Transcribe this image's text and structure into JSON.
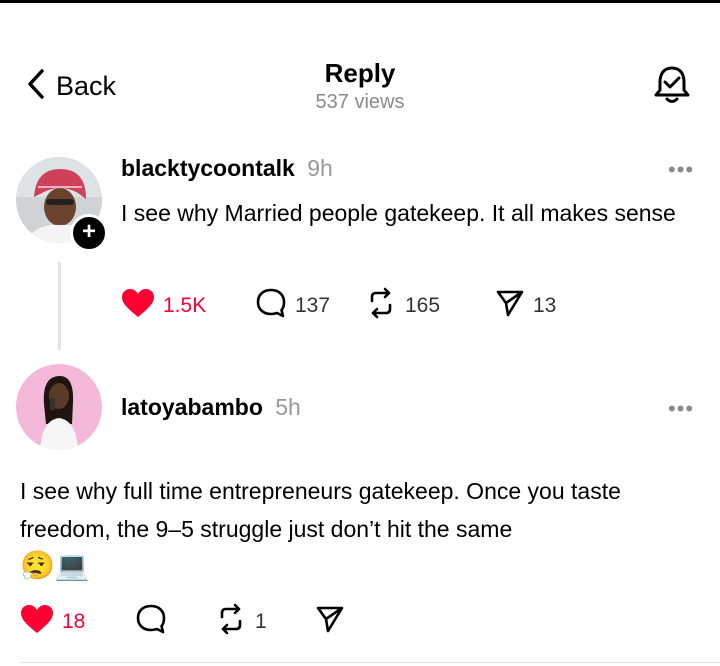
{
  "header": {
    "back_label": "Back",
    "title": "Reply",
    "views": "537 views"
  },
  "post1": {
    "username": "blacktycoontalk",
    "time": "9h",
    "text": "I see why Married people gatekeep. It all makes sense",
    "likes": "1.5K",
    "comments": "137",
    "reposts": "165",
    "shares": "13",
    "more_label": "•••"
  },
  "post2": {
    "username": "latoyabambo",
    "time": "5h",
    "text": "I see why full time entrepreneurs gatekeep. Once you taste freedom, the 9–5 struggle just don’t hit the same",
    "emoji": "😮‍💨💻",
    "likes": "18",
    "reposts": "1",
    "more_label": "•••"
  },
  "colors": {
    "like_red": "#ff0033",
    "muted": "#8a8a8a"
  },
  "icons": [
    "chevron-left-icon",
    "bell-check-icon",
    "heart-icon",
    "comment-icon",
    "repost-icon",
    "send-icon",
    "plus-icon",
    "more-icon"
  ]
}
